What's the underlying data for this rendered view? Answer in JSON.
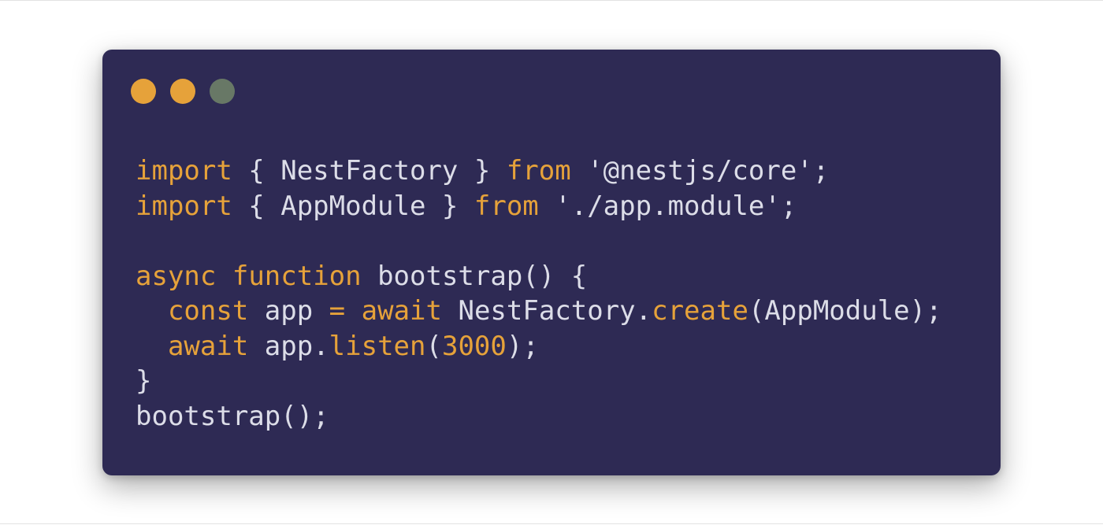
{
  "window": {
    "controls": [
      {
        "name": "dot-1",
        "color": "#e6a23a"
      },
      {
        "name": "dot-2",
        "color": "#e6a23a"
      },
      {
        "name": "dot-3",
        "color": "#687866"
      }
    ],
    "background": "#2e2a54"
  },
  "code": {
    "lines": [
      [
        {
          "type": "keyword",
          "text": "import"
        },
        {
          "type": "plain",
          "text": " { NestFactory } "
        },
        {
          "type": "keyword",
          "text": "from"
        },
        {
          "type": "plain",
          "text": " "
        },
        {
          "type": "string",
          "text": "'@nestjs/core'"
        },
        {
          "type": "plain",
          "text": ";"
        }
      ],
      [
        {
          "type": "keyword",
          "text": "import"
        },
        {
          "type": "plain",
          "text": " { AppModule } "
        },
        {
          "type": "keyword",
          "text": "from"
        },
        {
          "type": "plain",
          "text": " "
        },
        {
          "type": "string",
          "text": "'./app.module'"
        },
        {
          "type": "plain",
          "text": ";"
        }
      ],
      [],
      [
        {
          "type": "keyword",
          "text": "async"
        },
        {
          "type": "plain",
          "text": " "
        },
        {
          "type": "keyword",
          "text": "function"
        },
        {
          "type": "plain",
          "text": " bootstrap() {"
        }
      ],
      [
        {
          "type": "plain",
          "text": "  "
        },
        {
          "type": "keyword",
          "text": "const"
        },
        {
          "type": "plain",
          "text": " app "
        },
        {
          "type": "keyword",
          "text": "="
        },
        {
          "type": "plain",
          "text": " "
        },
        {
          "type": "keyword",
          "text": "await"
        },
        {
          "type": "plain",
          "text": " NestFactory."
        },
        {
          "type": "func",
          "text": "create"
        },
        {
          "type": "plain",
          "text": "(AppModule);"
        }
      ],
      [
        {
          "type": "plain",
          "text": "  "
        },
        {
          "type": "keyword",
          "text": "await"
        },
        {
          "type": "plain",
          "text": " app."
        },
        {
          "type": "func",
          "text": "listen"
        },
        {
          "type": "plain",
          "text": "("
        },
        {
          "type": "number",
          "text": "3000"
        },
        {
          "type": "plain",
          "text": ");"
        }
      ],
      [
        {
          "type": "plain",
          "text": "}"
        }
      ],
      [
        {
          "type": "plain",
          "text": "bootstrap();"
        }
      ]
    ]
  }
}
